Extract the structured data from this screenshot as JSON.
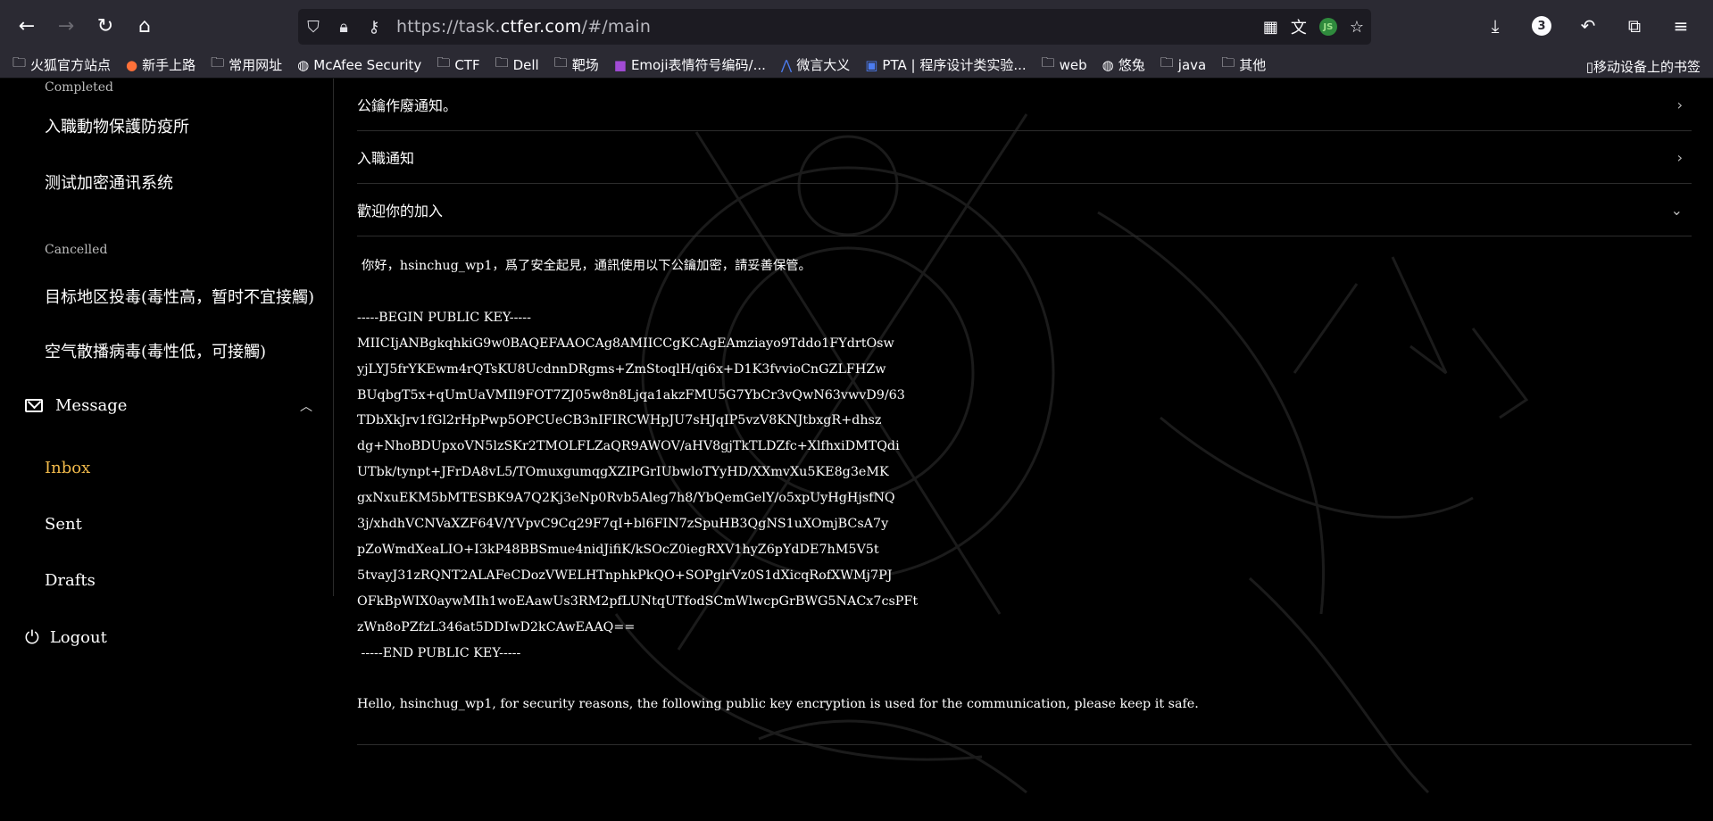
{
  "browser": {
    "url_prefix": "https://task.",
    "url_domain": "ctfer.com",
    "url_suffix": "/#/main",
    "download_count": "3",
    "bookmarks": [
      {
        "label": "火狐官方站点",
        "icon": "folder-icon"
      },
      {
        "label": "新手上路",
        "icon": "firefox-icon"
      },
      {
        "label": "常用网址",
        "icon": "folder-icon"
      },
      {
        "label": "McAfee Security",
        "icon": "globe-icon"
      },
      {
        "label": "CTF",
        "icon": "folder-icon"
      },
      {
        "label": "Dell",
        "icon": "folder-icon"
      },
      {
        "label": "靶场",
        "icon": "folder-icon"
      },
      {
        "label": "Emoji表情符号编码/...",
        "icon": "emoji-icon"
      },
      {
        "label": "微言大义",
        "icon": "logo-icon"
      },
      {
        "label": "PTA | 程序设计类实验...",
        "icon": "pta-icon"
      },
      {
        "label": "web",
        "icon": "folder-icon"
      },
      {
        "label": "悠兔",
        "icon": "globe-icon"
      },
      {
        "label": "java",
        "icon": "folder-icon"
      },
      {
        "label": "其他",
        "icon": "folder-icon"
      }
    ],
    "mobile_bookmarks": "移动设备上的书签"
  },
  "sidebar": {
    "completed_label": "Completed",
    "completed_items": [
      "入職動物保護防疫所",
      "测试加密通讯系统"
    ],
    "cancelled_label": "Cancelled",
    "cancelled_items": [
      "目标地区投毒(毒性高，暂时不宜接觸)",
      "空气散播病毒(毒性低，可接觸)"
    ],
    "message_label": "Message",
    "message_items": [
      "Inbox",
      "Sent",
      "Drafts"
    ],
    "logout_label": "Logout"
  },
  "messages": {
    "rows": [
      "公鑰作廢通知。",
      "入職通知",
      "歡迎你的加入"
    ],
    "greeting_cn": "你好，hsinchug_wp1，爲了安全起見，通訊使用以下公鑰加密，請妥善保管。",
    "key_lines": [
      "-----BEGIN PUBLIC KEY-----",
      "MIICIjANBgkqhkiG9w0BAQEFAAOCAg8AMIICCgKCAgEAmziayo9Tddo1FYdrtOsw",
      "yjLYJ5frYKEwm4rQTsKU8UcdnnDRgms+ZmStoqlH/qi6x+D1K3fvvioCnGZLFHZw",
      "BUqbgT5x+qUmUaVMIl9FOT7ZJ05w8n8Ljqa1akzFMU5G7YbCr3vQwN63vwvD9/63",
      "TDbXkJrv1fGl2rHpPwp5OPCUeCB3nIFIRCWHpJU7sHJqIP5vzV8KNJtbxgR+dhsz",
      "dg+NhoBDUpxoVN5lzSKr2TMOLFLZaQR9AWOV/aHV8gjTkTLDZfc+XlfhxiDMTQdi",
      "UTbk/tynpt+JFrDA8vL5/TOmuxgumqgXZIPGrIUbwloTYyHD/XXmvXu5KE8g3eMK",
      "gxNxuEKM5bMTESBK9A7Q2Kj3eNp0Rvb5Aleg7h8/YbQemGelY/o5xpUyHgHjsfNQ",
      "3j/xhdhVCNVaXZF64V/YVpvC9Cq29F7qI+bl6FIN7zSpuHB3QgNS1uXOmjBCsA7y",
      "pZoWmdXeaLIO+I3kP48BBSmue4nidJifiK/kSOcZ0iegRXV1hyZ6pYdDE7hM5V5t",
      "5tvayJ31zRQNT2ALAFeCDozVWELHTnphkPkQO+SOPglrVz0S1dXicqRofXWMj7PJ",
      "OFkBpWIX0aywMIh1woEAawUs3RM2pfLUNtqUTfodSCmWlwcpGrBWG5NACx7csPFt",
      "zWn8oPZfzL346at5DDIwD2kCAwEAAQ==",
      " -----END PUBLIC KEY-----"
    ],
    "greeting_en": "Hello, hsinchug_wp1, for security reasons, the following public key encryption is used for the communication, please keep it safe."
  }
}
